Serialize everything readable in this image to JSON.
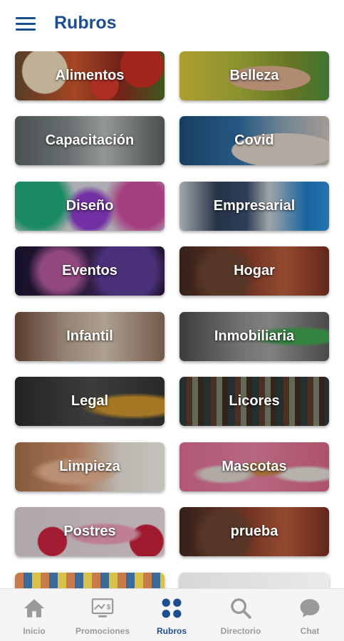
{
  "header": {
    "title": "Rubros",
    "menu_icon": "hamburger-menu-icon"
  },
  "categories": [
    {
      "label": "Alimentos"
    },
    {
      "label": "Belleza"
    },
    {
      "label": "Capacitación"
    },
    {
      "label": "Covid"
    },
    {
      "label": "Diseño"
    },
    {
      "label": "Empresarial"
    },
    {
      "label": "Eventos"
    },
    {
      "label": "Hogar"
    },
    {
      "label": "Infantil"
    },
    {
      "label": "Inmobiliaria"
    },
    {
      "label": "Legal"
    },
    {
      "label": "Licores"
    },
    {
      "label": "Limpieza"
    },
    {
      "label": "Mascotas"
    },
    {
      "label": "Postres"
    },
    {
      "label": "prueba"
    }
  ],
  "bottom_nav": {
    "items": [
      {
        "label": "Inicio",
        "icon": "home-icon"
      },
      {
        "label": "Promociones",
        "icon": "promotions-monitor-icon"
      },
      {
        "label": "Rubros",
        "icon": "categories-grid-icon",
        "active": true
      },
      {
        "label": "Directorio",
        "icon": "search-icon"
      },
      {
        "label": "Chat",
        "icon": "chat-bubble-icon"
      }
    ]
  },
  "colors": {
    "primary": "#1d4f8f",
    "inactive": "#9a9a9a",
    "nav_bg": "#f5f5f5"
  }
}
